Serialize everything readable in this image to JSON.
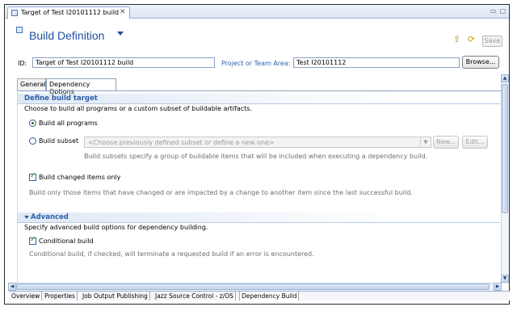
{
  "editor_tab": {
    "label": "Target of Test I20101112 build",
    "close": "✕"
  },
  "window_buttons": {
    "minimize": "▭",
    "maximize": "▢"
  },
  "header": {
    "title": "Build Definition",
    "save_label": "Save"
  },
  "fields": {
    "id_label": "ID:",
    "id_value": "Target of Test I20101112 build",
    "area_label": "Project or Team Area:",
    "area_value": "Test I20101112",
    "browse_label": "Browse..."
  },
  "tabs": [
    {
      "label": "General"
    },
    {
      "label": "Dependency Options"
    }
  ],
  "define_target": {
    "title": "Define build target",
    "description": "Choose to build all programs or a custom subset of buildable artifacts.",
    "build_all_label": "Build all programs",
    "build_subset_label": "Build subset",
    "subset_placeholder": "<Choose previously defined subset or define a new one>",
    "new_label": "New...",
    "edit_label": "Edit...",
    "subset_help": "Build subsets specify a group of buildable items that will be included when executing a dependency build.",
    "changed_only_label": "Build changed items only",
    "changed_only_help": "Build only those items that have changed or are impacted by a change to another item since the last successful build."
  },
  "advanced": {
    "title": "Advanced",
    "description": "Specify advanced build options for dependency building.",
    "conditional_label": "Conditional build",
    "conditional_help": "Conditional build, if checked, will terminate a requested build if an error is encountered."
  },
  "bottom_tabs": [
    {
      "label": "Overview"
    },
    {
      "label": "Properties"
    },
    {
      "label": "Job Output Publishing"
    },
    {
      "label": "Jazz Source Control - z/OS"
    },
    {
      "label": "Dependency Build"
    }
  ],
  "scroll": {
    "up": "▲",
    "down": "▼",
    "left": "◀",
    "right": "▶",
    "dropdown": "▼"
  }
}
